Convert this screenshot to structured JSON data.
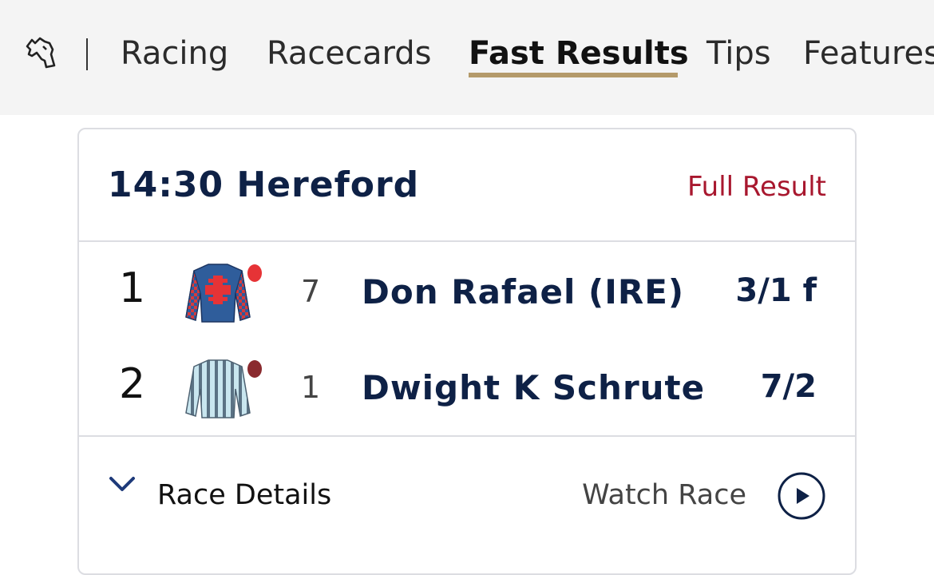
{
  "nav": {
    "logo_icon": "horse-head-icon",
    "items": [
      {
        "label": "Racing"
      },
      {
        "label": "Racecards"
      },
      {
        "label": "Fast Results",
        "active": true
      },
      {
        "label": "Tips"
      },
      {
        "label": "Features"
      }
    ],
    "active_underline_color": "#b49a6a"
  },
  "result_card": {
    "title": "14:30 Hereford",
    "full_result_label": "Full Result",
    "full_result_color": "#a8172e",
    "runners": [
      {
        "position": "1",
        "number": "7",
        "horse": "Don Rafael (IRE)",
        "odds": "3/1 f",
        "silk_icon": "silk-blue-red-cross-icon"
      },
      {
        "position": "2",
        "number": "1",
        "horse": "Dwight K Schrute",
        "odds": "7/2",
        "silk_icon": "silk-light-blue-stripes-icon"
      }
    ],
    "race_details_label": "Race Details",
    "watch_race_label": "Watch Race"
  },
  "colors": {
    "primary_navy": "#0e2146",
    "nav_background": "#f4f4f4",
    "border": "#dcdde2"
  }
}
